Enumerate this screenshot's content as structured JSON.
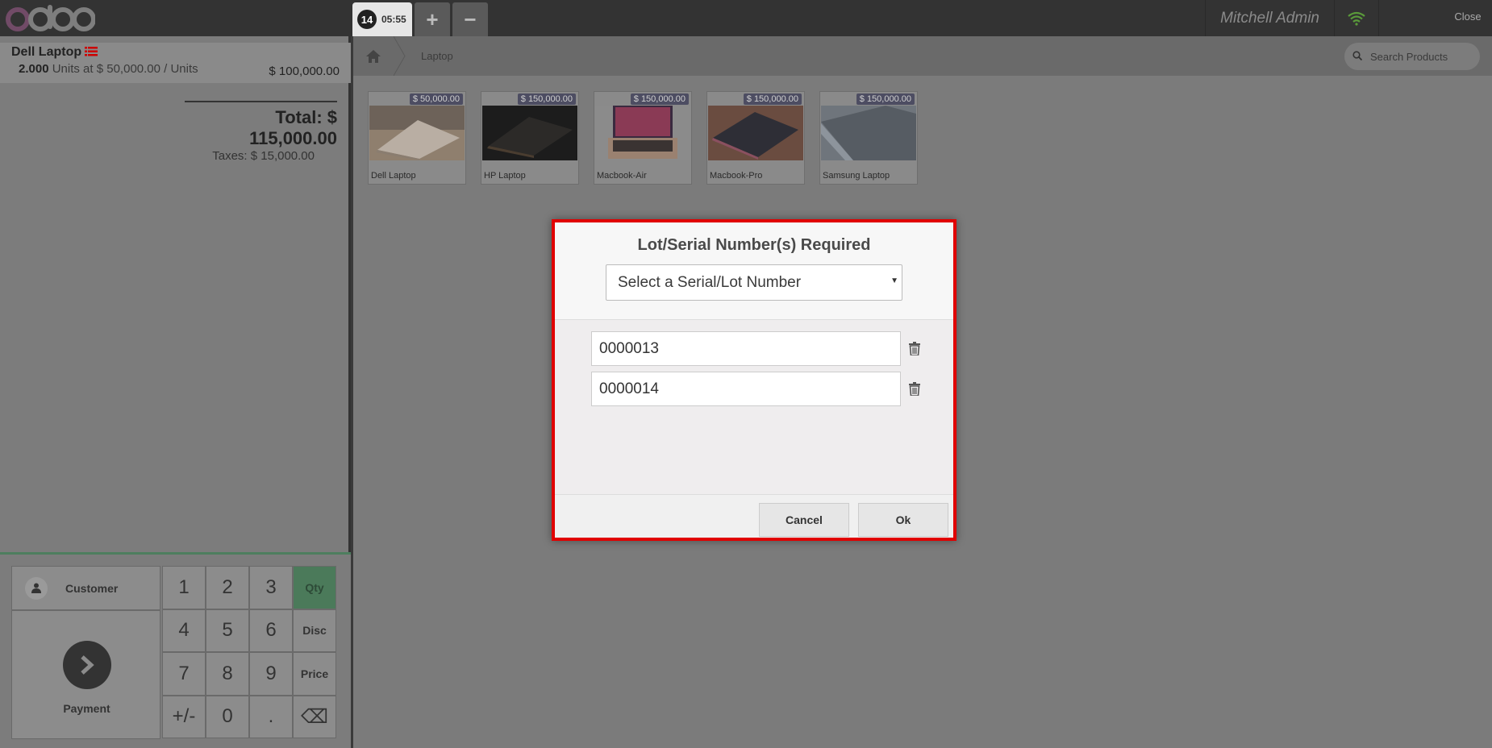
{
  "header": {
    "logo": "odoo",
    "order": {
      "number": "14",
      "time": "05:55"
    },
    "add_order": "+",
    "remove_order": "−",
    "user": "Mitchell Admin",
    "close_label": "Close"
  },
  "order": {
    "lines": [
      {
        "name": "Dell Laptop",
        "qty": "2.000",
        "unit_text": " Units at $ 50,000.00 / Units",
        "price": "$ 100,000.00"
      }
    ],
    "total": "Total: $ 115,000.00",
    "taxes": "Taxes: $ 15,000.00"
  },
  "pad": {
    "customer": "Customer",
    "payment": "Payment",
    "keys": [
      "1",
      "2",
      "3",
      "Qty",
      "4",
      "5",
      "6",
      "Disc",
      "7",
      "8",
      "9",
      "Price",
      "+/-",
      "0",
      ".",
      "⌫"
    ],
    "active_mode": "Qty"
  },
  "breadcrumb": {
    "category": "Laptop"
  },
  "search": {
    "placeholder": "Search Products"
  },
  "products": [
    {
      "name": "Dell Laptop",
      "price": "$ 50,000.00"
    },
    {
      "name": "HP Laptop",
      "price": "$ 150,000.00"
    },
    {
      "name": "Macbook-Air",
      "price": "$ 150,000.00"
    },
    {
      "name": "Macbook-Pro",
      "price": "$ 150,000.00"
    },
    {
      "name": "Samsung Laptop",
      "price": "$ 150,000.00"
    }
  ],
  "modal": {
    "title": "Lot/Serial Number(s) Required",
    "select_placeholder": "Select a Serial/Lot Number",
    "lots": [
      "0000013",
      "0000014"
    ],
    "cancel": "Cancel",
    "ok": "Ok"
  },
  "colors": {
    "accent": "#e00000",
    "qty_active": "#4b7a5a",
    "odoo_purple": "#714b67"
  }
}
